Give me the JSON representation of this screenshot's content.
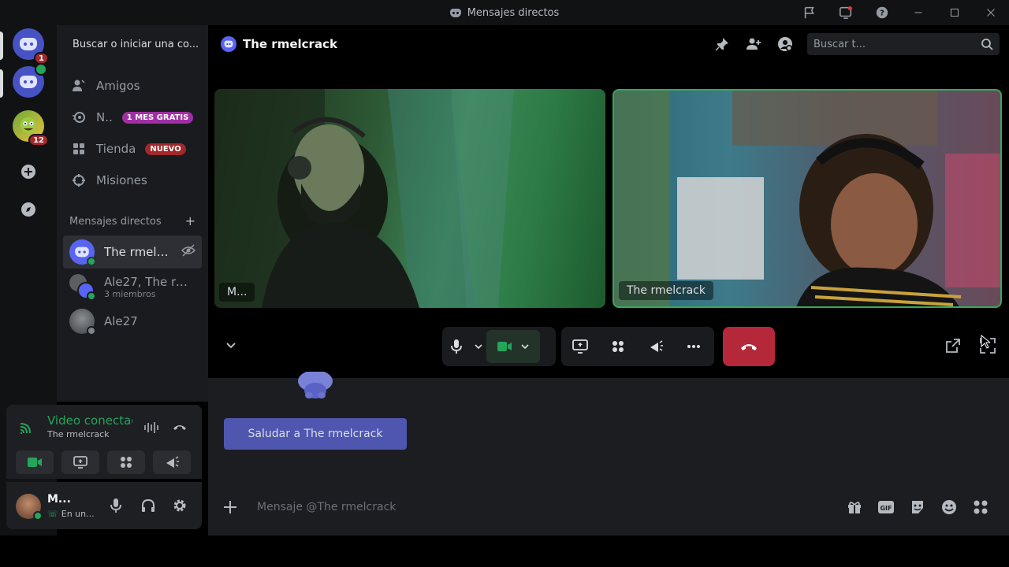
{
  "window": {
    "title": "Mensajes directos",
    "controls": [
      "inbox-icon",
      "screen-share-icon",
      "help-icon",
      "minimize-icon",
      "maximize-icon",
      "close-icon"
    ]
  },
  "rail": {
    "items": [
      {
        "name": "home",
        "badge": "1"
      },
      {
        "name": "dm-server",
        "badge": ""
      },
      {
        "name": "avatar-server",
        "badge": "12"
      }
    ]
  },
  "sidebar": {
    "search_label": "Buscar o iniciar una co...",
    "nav": [
      {
        "label": "Amigos",
        "icon": "friends-icon",
        "badge": ""
      },
      {
        "label": "N..",
        "icon": "nitro-icon",
        "badge": "1 MES GRATIS",
        "badge_color": "#a02fa3"
      },
      {
        "label": "Tienda",
        "icon": "shop-icon",
        "badge": "NUEVO",
        "badge_color": "#a1282b"
      },
      {
        "label": "Misiones",
        "icon": "quests-icon",
        "badge": ""
      }
    ],
    "dm_header": "Mensajes directos",
    "dms": [
      {
        "name": "The rmelc...",
        "sub": "",
        "status": "online"
      },
      {
        "name": "Ale27, The rm...",
        "sub": "3 miembros",
        "status": "online"
      },
      {
        "name": "Ale27",
        "sub": "",
        "status": "offline"
      }
    ]
  },
  "voice": {
    "status": "Video conectad",
    "channel": "The rmelcrack"
  },
  "user": {
    "name": "M...",
    "status": "En un..."
  },
  "header": {
    "title": "The rmelcrack",
    "search_placeholder": "Buscar t..."
  },
  "video": {
    "tiles": [
      {
        "label": "M...",
        "speaking": false
      },
      {
        "label": "The rmelcrack",
        "speaking": true
      }
    ]
  },
  "chat": {
    "greet_button": "Saludar a The rmelcrack",
    "input_placeholder": "Mensaje @The rmelcrack"
  },
  "colors": {
    "accent": "#5865f2",
    "online": "#23a55a",
    "hangup": "#b5283a",
    "speaking_border": "#3ba55c"
  }
}
